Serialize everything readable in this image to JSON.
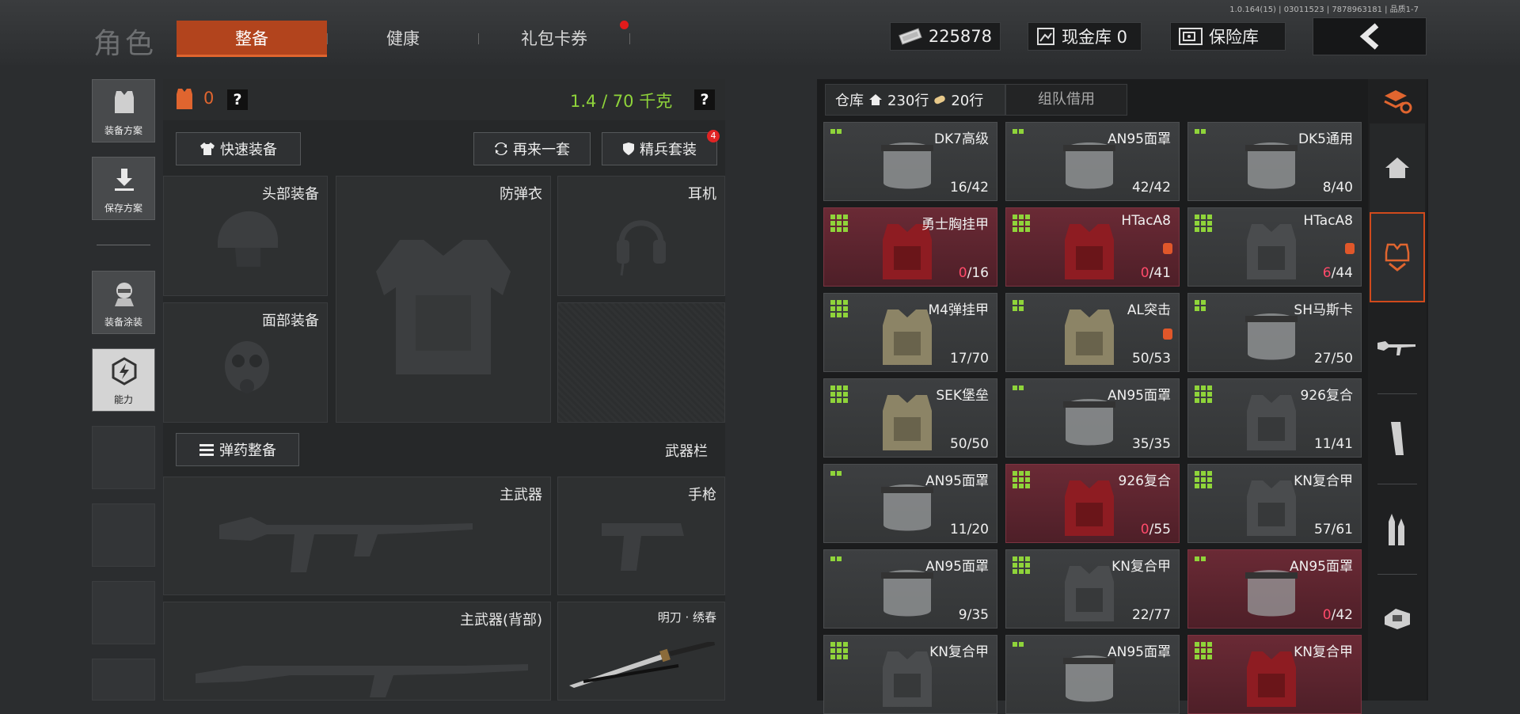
{
  "version": "1.0.164(15) | 03011523 | 7878963181 | 品质1-7",
  "title": "角色",
  "tabs": [
    {
      "label": "整备",
      "active": true
    },
    {
      "label": "健康",
      "active": false
    },
    {
      "label": "礼包卡券",
      "active": false,
      "notify": true
    }
  ],
  "currency": {
    "icon": "cash-icon",
    "value": "225878"
  },
  "cash_vault": {
    "icon": "vault-image-icon",
    "label": "现金库 0"
  },
  "safe": {
    "icon": "safe-icon",
    "label": "保险库"
  },
  "left_nav": [
    {
      "label": "装备方案",
      "icon": "vest-icon"
    },
    {
      "label": "保存方案",
      "icon": "download-icon"
    },
    {
      "label": "装备涂装",
      "icon": "operator-icon"
    },
    {
      "label": "能力",
      "icon": "ability-icon",
      "active": true
    }
  ],
  "loadout": {
    "armor_count": "0",
    "weight": "1.4 / 70 千克",
    "help": "?",
    "quick_equip": "快速装备",
    "again": "再来一套",
    "elite": "精兵套装",
    "elite_badge": "4",
    "slots": {
      "head": "头部装备",
      "vest": "防弹衣",
      "ear": "耳机",
      "face": "面部装备"
    },
    "ammo_btn": "弹药整备",
    "weapon_bar": "武器栏",
    "weapons": {
      "primary": "主武器",
      "pistol": "手枪",
      "primary_back": "主武器(背部)",
      "melee": "明刀 · 绣春"
    }
  },
  "warehouse": {
    "tab_label": "仓库",
    "rows_home": "230行",
    "rows_extra": "20行",
    "team_borrow": "组队借用",
    "items": [
      {
        "name": "DK7高级",
        "cur": "16",
        "max": "42",
        "red": false,
        "grid": 2,
        "zero": false
      },
      {
        "name": "AN95面罩",
        "cur": "42",
        "max": "42",
        "red": false,
        "grid": 2,
        "zero": false
      },
      {
        "name": "DK5通用",
        "cur": "8",
        "max": "40",
        "red": false,
        "grid": 2,
        "zero": false
      },
      {
        "name": "勇士胸挂甲",
        "cur": "0",
        "max": "16",
        "red": true,
        "grid": 9,
        "zero": true
      },
      {
        "name": "HTacA8",
        "cur": "0",
        "max": "41",
        "red": true,
        "grid": 9,
        "zero": true,
        "tag": true
      },
      {
        "name": "HTacA8",
        "cur": "6",
        "max": "44",
        "red": false,
        "grid": 9,
        "zero": true,
        "tag": true
      },
      {
        "name": "M4弹挂甲",
        "cur": "17",
        "max": "70",
        "red": false,
        "grid": 9,
        "zero": false
      },
      {
        "name": "AL突击",
        "cur": "50",
        "max": "53",
        "red": false,
        "grid": 4,
        "zero": false,
        "tag": true
      },
      {
        "name": "SH马斯卡",
        "cur": "27",
        "max": "50",
        "red": false,
        "grid": 4,
        "zero": false
      },
      {
        "name": "SEK堡垒",
        "cur": "50",
        "max": "50",
        "red": false,
        "grid": 9,
        "zero": false
      },
      {
        "name": "AN95面罩",
        "cur": "35",
        "max": "35",
        "red": false,
        "grid": 2,
        "zero": false
      },
      {
        "name": "926复合",
        "cur": "11",
        "max": "41",
        "red": false,
        "grid": 9,
        "zero": false
      },
      {
        "name": "AN95面罩",
        "cur": "11",
        "max": "20",
        "red": false,
        "grid": 2,
        "zero": false
      },
      {
        "name": "926复合",
        "cur": "0",
        "max": "55",
        "red": true,
        "grid": 9,
        "zero": true
      },
      {
        "name": "KN复合甲",
        "cur": "57",
        "max": "61",
        "red": false,
        "grid": 9,
        "zero": false
      },
      {
        "name": "AN95面罩",
        "cur": "9",
        "max": "35",
        "red": false,
        "grid": 2,
        "zero": false
      },
      {
        "name": "KN复合甲",
        "cur": "22",
        "max": "77",
        "red": false,
        "grid": 9,
        "zero": false
      },
      {
        "name": "AN95面罩",
        "cur": "0",
        "max": "42",
        "red": true,
        "grid": 2,
        "zero": true
      },
      {
        "name": "KN复合甲",
        "cur": "",
        "max": "",
        "red": false,
        "grid": 9,
        "zero": false
      },
      {
        "name": "AN95面罩",
        "cur": "",
        "max": "",
        "red": false,
        "grid": 2,
        "zero": false
      },
      {
        "name": "KN复合甲",
        "cur": "",
        "max": "",
        "red": true,
        "grid": 9,
        "zero": false
      }
    ]
  },
  "rail": [
    "layers-swap-icon",
    "home-icon",
    "armor-filter-icon",
    "rifle-icon",
    "magazine-icon",
    "ammo-icon",
    "scope-icon"
  ]
}
